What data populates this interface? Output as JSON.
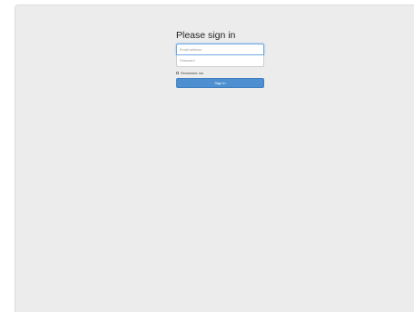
{
  "signin": {
    "heading": "Please sign in",
    "email_placeholder": "Email address",
    "password_placeholder": "Password",
    "remember_label": "Remember me",
    "submit_label": "Sign in"
  },
  "colors": {
    "primary_button": "#4d8fd0",
    "page_background": "#ececec",
    "focus_border": "#6ea6e0"
  }
}
